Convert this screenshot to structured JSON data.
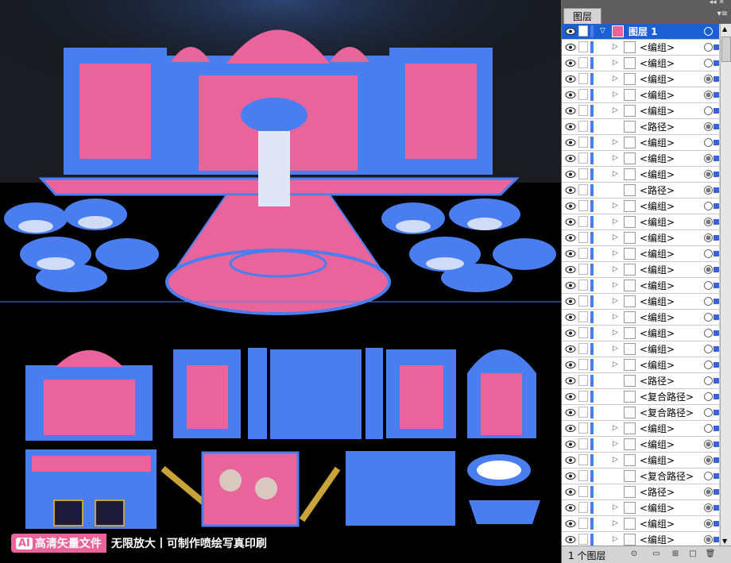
{
  "banner": {
    "badge_ai": "AI",
    "badge_text": "高清矢量文件",
    "slogan": "无限放大丨可制作喷绘写真印刷"
  },
  "colors": {
    "pink": "#e8649a",
    "blue": "#4a7ef0",
    "selection": "#1c5fd2",
    "canvas": "#000000"
  },
  "panel": {
    "tab_label": "图层",
    "top_layer": {
      "label": "图层 1"
    },
    "rows": [
      {
        "label": "<编组>",
        "target": "empty"
      },
      {
        "label": "<编组>",
        "target": "empty"
      },
      {
        "label": "<编组>",
        "target": "filled"
      },
      {
        "label": "<编组>",
        "target": "filled"
      },
      {
        "label": "<编组>",
        "target": "empty"
      },
      {
        "label": "<路径>",
        "target": "filled"
      },
      {
        "label": "<编组>",
        "target": "empty"
      },
      {
        "label": "<编组>",
        "target": "filled"
      },
      {
        "label": "<编组>",
        "target": "filled"
      },
      {
        "label": "<路径>",
        "target": "filled"
      },
      {
        "label": "<编组>",
        "target": "empty"
      },
      {
        "label": "<编组>",
        "target": "filled"
      },
      {
        "label": "<编组>",
        "target": "filled"
      },
      {
        "label": "<编组>",
        "target": "empty"
      },
      {
        "label": "<编组>",
        "target": "filled"
      },
      {
        "label": "<编组>",
        "target": "empty"
      },
      {
        "label": "<编组>",
        "target": "empty"
      },
      {
        "label": "<编组>",
        "target": "empty"
      },
      {
        "label": "<编组>",
        "target": "empty"
      },
      {
        "label": "<编组>",
        "target": "empty"
      },
      {
        "label": "<编组>",
        "target": "empty"
      },
      {
        "label": "<路径>",
        "target": "empty"
      },
      {
        "label": "<复合路径>",
        "target": "empty"
      },
      {
        "label": "<复合路径>",
        "target": "empty"
      },
      {
        "label": "<编组>",
        "target": "empty"
      },
      {
        "label": "<编组>",
        "target": "filled"
      },
      {
        "label": "<编组>",
        "target": "filled"
      },
      {
        "label": "<复合路径>",
        "target": "empty"
      },
      {
        "label": "<路径>",
        "target": "filled"
      },
      {
        "label": "<编组>",
        "target": "filled"
      },
      {
        "label": "<编组>",
        "target": "filled"
      },
      {
        "label": "<编组>",
        "target": "filled"
      }
    ],
    "footer": {
      "layer_count": "1 个图层"
    }
  }
}
